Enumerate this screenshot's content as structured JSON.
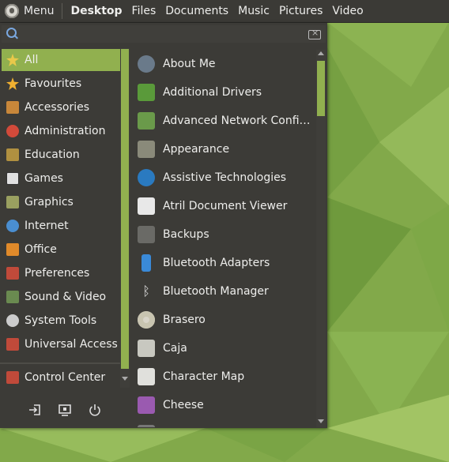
{
  "panel": {
    "menu_label": "Menu",
    "places": [
      "Desktop",
      "Files",
      "Documents",
      "Music",
      "Pictures",
      "Video"
    ]
  },
  "search": {
    "value": "",
    "placeholder": ""
  },
  "categories": [
    {
      "label": "All",
      "icon": "star-icon",
      "color": "#e9c84a"
    },
    {
      "label": "Favourites",
      "icon": "star-icon",
      "color": "#f0b030"
    },
    {
      "label": "Accessories",
      "icon": "accessories-icon",
      "color": "#c8873a"
    },
    {
      "label": "Administration",
      "icon": "administration-icon",
      "color": "#d24a3a"
    },
    {
      "label": "Education",
      "icon": "education-icon",
      "color": "#b09040"
    },
    {
      "label": "Games",
      "icon": "games-icon",
      "color": "#e0e0e0"
    },
    {
      "label": "Graphics",
      "icon": "graphics-icon",
      "color": "#9aa060"
    },
    {
      "label": "Internet",
      "icon": "internet-icon",
      "color": "#4a8ed0"
    },
    {
      "label": "Office",
      "icon": "office-icon",
      "color": "#e08a2a"
    },
    {
      "label": "Preferences",
      "icon": "preferences-icon",
      "color": "#c04a3a"
    },
    {
      "label": "Sound & Video",
      "icon": "sound-video-icon",
      "color": "#6a8a50"
    },
    {
      "label": "System Tools",
      "icon": "system-tools-icon",
      "color": "#cccccc"
    },
    {
      "label": "Universal Access",
      "icon": "universal-access-icon",
      "color": "#c04a3a"
    }
  ],
  "control_center": {
    "label": "Control Center",
    "icon": "control-center-icon",
    "color": "#c04a3a"
  },
  "apps": [
    {
      "label": "About Me",
      "icon": "about-me-icon",
      "color": "#6a7a8a"
    },
    {
      "label": "Additional Drivers",
      "icon": "additional-drivers-icon",
      "color": "#5a9a3a"
    },
    {
      "label": "Advanced Network Configu…",
      "icon": "network-icon",
      "color": "#6a9a4a"
    },
    {
      "label": "Appearance",
      "icon": "appearance-icon",
      "color": "#8a8a7a"
    },
    {
      "label": "Assistive Technologies",
      "icon": "accessibility-icon",
      "color": "#2a7ac0"
    },
    {
      "label": "Atril Document Viewer",
      "icon": "document-viewer-icon",
      "color": "#e8e8e8"
    },
    {
      "label": "Backups",
      "icon": "backups-icon",
      "color": "#6a6a66"
    },
    {
      "label": "Bluetooth Adapters",
      "icon": "bluetooth-adapter-icon",
      "color": "#3a8ad8"
    },
    {
      "label": "Bluetooth Manager",
      "icon": "bluetooth-icon",
      "color": "#dddddd"
    },
    {
      "label": "Brasero",
      "icon": "disc-icon",
      "color": "#d8d4c8"
    },
    {
      "label": "Caja",
      "icon": "file-manager-icon",
      "color": "#c8c8c0"
    },
    {
      "label": "Character Map",
      "icon": "character-map-icon",
      "color": "#e0e0dc"
    },
    {
      "label": "Cheese",
      "icon": "cheese-icon",
      "color": "#9a5ab0"
    }
  ],
  "colors": {
    "accent": "#91b04f",
    "panel": "#3b3a36",
    "menu_bg": "#3c3b37"
  }
}
